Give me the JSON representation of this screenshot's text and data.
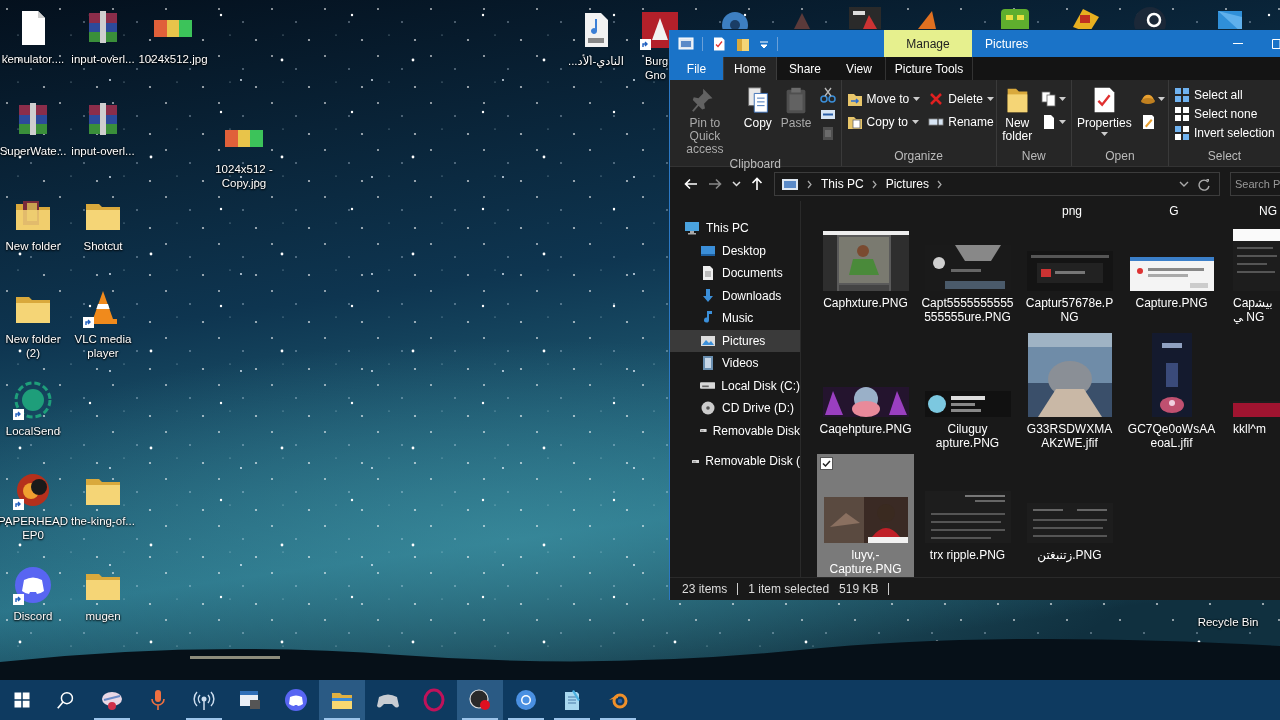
{
  "desktop_icons": [
    {
      "label": "kemulator....",
      "shortcut": false
    },
    {
      "label": "input-overl...",
      "shortcut": false
    },
    {
      "label": "1024x512.jpg",
      "shortcut": false
    },
    {
      "label": "SuperWate...",
      "shortcut": false
    },
    {
      "label": "input-overl...",
      "shortcut": false
    },
    {
      "label": "1024x512 - Copy.jpg",
      "shortcut": false
    },
    {
      "label": "New folder",
      "shortcut": false
    },
    {
      "label": "Shotcut",
      "shortcut": false
    },
    {
      "label": "New folder (2)",
      "shortcut": false
    },
    {
      "label": "VLC media player",
      "shortcut": true
    },
    {
      "label": "LocalSend",
      "shortcut": true
    },
    {
      "label": "PAPERHEAD EP0",
      "shortcut": true
    },
    {
      "label": "the-king-of...",
      "shortcut": false
    },
    {
      "label": "Discord",
      "shortcut": true
    },
    {
      "label": "mugen",
      "shortcut": false
    },
    {
      "label": "النادي-الأد...",
      "shortcut": false
    },
    {
      "label": "Burg Gno",
      "shortcut": true
    },
    {
      "label": "Recycle Bin",
      "shortcut": false
    }
  ],
  "explorer": {
    "context_tab": "Manage",
    "title": "Pictures",
    "tabs": [
      {
        "label": "File",
        "kind": "file",
        "selected": false
      },
      {
        "label": "Home",
        "kind": "tab",
        "selected": true
      },
      {
        "label": "Share",
        "kind": "tab",
        "selected": false
      },
      {
        "label": "View",
        "kind": "tab",
        "selected": false
      },
      {
        "label": "Picture Tools",
        "kind": "context",
        "selected": false
      }
    ],
    "groups": [
      {
        "label": "Clipboard",
        "commands": [
          {
            "label": "Pin to Quick access",
            "kind": "large",
            "disabled": true,
            "dropdown": false
          },
          {
            "label": "Copy",
            "kind": "large",
            "disabled": false,
            "dropdown": false
          },
          {
            "label": "Paste",
            "kind": "large",
            "disabled": true,
            "dropdown": false
          },
          {
            "kind": "icon",
            "disabled": false,
            "dropdown": false
          },
          {
            "kind": "icon",
            "disabled": false,
            "dropdown": false
          },
          {
            "kind": "icon",
            "disabled": true,
            "dropdown": false
          }
        ]
      },
      {
        "label": "Organize",
        "commands": [
          {
            "label": "Move to",
            "kind": "small",
            "disabled": false,
            "dropdown": true
          },
          {
            "label": "Copy to",
            "kind": "small",
            "disabled": false,
            "dropdown": true
          },
          {
            "label": "Delete",
            "kind": "small",
            "disabled": false,
            "dropdown": true
          },
          {
            "label": "Rename",
            "kind": "small",
            "disabled": false,
            "dropdown": false
          }
        ]
      },
      {
        "label": "New",
        "commands": [
          {
            "label": "New folder",
            "kind": "large",
            "disabled": false,
            "dropdown": false
          },
          {
            "kind": "icon",
            "disabled": false,
            "dropdown": true
          },
          {
            "kind": "icon",
            "disabled": false,
            "dropdown": true
          }
        ]
      },
      {
        "label": "Open",
        "commands": [
          {
            "label": "Properties",
            "kind": "large",
            "disabled": false,
            "dropdown": true
          },
          {
            "kind": "icon",
            "disabled": false,
            "dropdown": true
          },
          {
            "kind": "icon",
            "disabled": false,
            "dropdown": false
          }
        ]
      },
      {
        "label": "Select",
        "commands": [
          {
            "label": "Select all",
            "kind": "small",
            "disabled": false,
            "dropdown": false
          },
          {
            "label": "Select none",
            "kind": "small",
            "disabled": false,
            "dropdown": false
          },
          {
            "label": "Invert selection",
            "kind": "small",
            "disabled": false,
            "dropdown": false
          }
        ]
      }
    ],
    "breadcrumbs": [
      "This PC",
      "Pictures"
    ],
    "search": {
      "placeholder": "Search P"
    },
    "nav": [
      {
        "label": "This PC",
        "selected": false,
        "children": [
          {
            "label": "Desktop",
            "selected": false
          },
          {
            "label": "Documents",
            "selected": false
          },
          {
            "label": "Downloads",
            "selected": false
          },
          {
            "label": "Music",
            "selected": false
          },
          {
            "label": "Pictures",
            "selected": true
          },
          {
            "label": "Videos",
            "selected": false
          },
          {
            "label": "Local Disk (C:)",
            "selected": false
          },
          {
            "label": "CD Drive (D:)",
            "selected": false
          },
          {
            "label": "Removable Disk",
            "selected": false
          }
        ]
      },
      {
        "label": "Removable Disk (",
        "selected": false
      }
    ],
    "partial_row": [
      "png",
      "G",
      "NG"
    ],
    "files": [
      {
        "name": "Caphxture.PNG",
        "selected": false
      },
      {
        "name": "Capt5555555555555555ure.PNG",
        "selected": false
      },
      {
        "name": "Captur57678e.PNG",
        "selected": false
      },
      {
        "name": "Capture.PNG",
        "selected": false
      },
      {
        "name": "Capبيشي NG",
        "selected": false
      },
      {
        "name": "Caqehpture.PNG",
        "selected": false
      },
      {
        "name": "Ciluguy apture.PNG",
        "selected": false
      },
      {
        "name": "G33RSDWXMAAKzWE.jfif",
        "selected": false
      },
      {
        "name": "GC7Qe0oWsAAeoaL.jfif",
        "selected": false
      },
      {
        "name": "kkll^m",
        "selected": false
      },
      {
        "name": "luyv,-Capture.PNG",
        "selected": true
      },
      {
        "name": "trx ripple.PNG",
        "selected": false
      },
      {
        "name": "زتنبغتن.PNG",
        "selected": false
      }
    ],
    "status": {
      "items": "23 items",
      "selection": "1 item selected",
      "size": "519 KB"
    }
  },
  "taskbar": [
    {
      "kind": "start"
    },
    {
      "kind": "search"
    },
    {
      "kind": "app",
      "running": true,
      "highlighted": false
    },
    {
      "kind": "app",
      "running": false,
      "highlighted": false
    },
    {
      "kind": "app",
      "running": true,
      "highlighted": false
    },
    {
      "kind": "app",
      "running": false,
      "highlighted": false
    },
    {
      "kind": "app",
      "running": false,
      "highlighted": false
    },
    {
      "kind": "app",
      "running": true,
      "highlighted": true
    },
    {
      "kind": "app",
      "running": false,
      "highlighted": false
    },
    {
      "kind": "app",
      "running": false,
      "highlighted": false
    },
    {
      "kind": "app",
      "running": true,
      "highlighted": true
    },
    {
      "kind": "app",
      "running": true,
      "highlighted": false
    },
    {
      "kind": "app",
      "running": true,
      "highlighted": false
    },
    {
      "kind": "app",
      "running": true,
      "highlighted": false
    }
  ]
}
